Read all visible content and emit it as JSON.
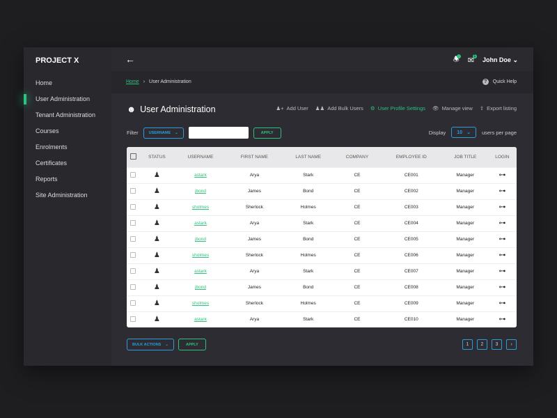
{
  "brand": "PROJECT X",
  "sidebar": {
    "items": [
      {
        "label": "Home"
      },
      {
        "label": "User Administration"
      },
      {
        "label": "Tenant Administration"
      },
      {
        "label": "Courses"
      },
      {
        "label": "Enrolments"
      },
      {
        "label": "Certificates"
      },
      {
        "label": "Reports"
      },
      {
        "label": "Site Administration"
      }
    ]
  },
  "topbar": {
    "user": "John Doe",
    "mail_count": "1"
  },
  "breadcrumb": {
    "home": "Home",
    "current": "User Administration"
  },
  "quick_help": "Quick Help",
  "page_title": "User Administration",
  "actions": {
    "add_user": "Add User",
    "add_bulk": "Add Bulk Users",
    "profile_settings": "User Profile Settings",
    "manage_view": "Manage view",
    "export": "Export listing"
  },
  "filter": {
    "label": "Filter",
    "field": "USERNAME",
    "value": "",
    "apply": "APPLY"
  },
  "display": {
    "label": "Display",
    "value": "10",
    "suffix": "users per page"
  },
  "table": {
    "headers": [
      "STATUS",
      "USERNAME",
      "FIRST NAME",
      "LAST NAME",
      "COMPANY",
      "EMPLOYEE ID",
      "JOB TITLE",
      "LOGIN"
    ],
    "rows": [
      [
        "astark",
        "Arya",
        "Stark",
        "CE",
        "CE001",
        "Manager"
      ],
      [
        "jbond",
        "James",
        "Bond",
        "CE",
        "CE002",
        "Manager"
      ],
      [
        "sholmes",
        "Sherlock",
        "Holmes",
        "CE",
        "CE003",
        "Manager"
      ],
      [
        "astark",
        "Arya",
        "Stark",
        "CE",
        "CE004",
        "Manager"
      ],
      [
        "jbond",
        "James",
        "Bond",
        "CE",
        "CE005",
        "Manager"
      ],
      [
        "sholmes",
        "Sherlock",
        "Holmes",
        "CE",
        "CE006",
        "Manager"
      ],
      [
        "astark",
        "Arya",
        "Stark",
        "CE",
        "CE007",
        "Manager"
      ],
      [
        "jbond",
        "James",
        "Bond",
        "CE",
        "CE008",
        "Manager"
      ],
      [
        "sholmes",
        "Sherlock",
        "Holmes",
        "CE",
        "CE009",
        "Manager"
      ],
      [
        "astark",
        "Arya",
        "Stark",
        "CE",
        "CE010",
        "Manager"
      ]
    ]
  },
  "bulk": {
    "label": "BULK ACTIONS",
    "apply": "APPLY"
  },
  "pagination": [
    "1",
    "2",
    "3"
  ]
}
